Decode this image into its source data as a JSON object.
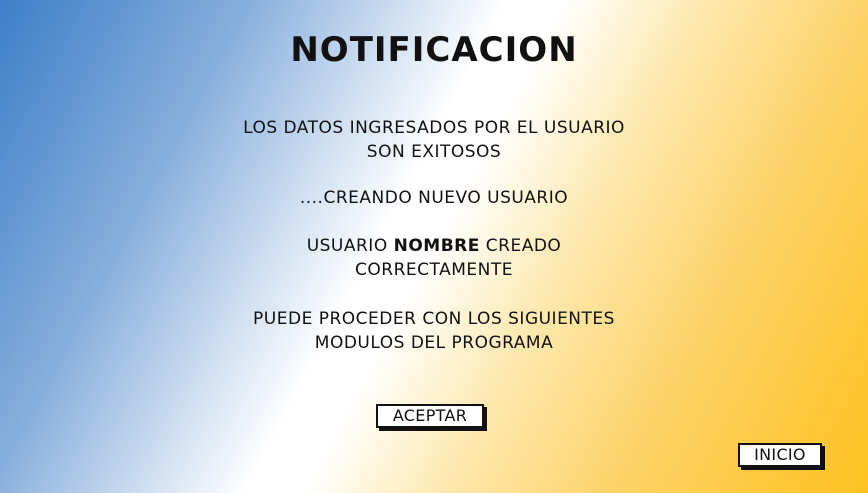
{
  "title": "NOTIFICACION",
  "messages": {
    "success_line1": "LOS DATOS INGRESADOS POR EL USUARIO",
    "success_line2": "SON EXITOSOS",
    "creating": "....CREANDO NUEVO USUARIO",
    "created_prefix": "USUARIO ",
    "created_name": "NOMBRE",
    "created_suffix": " CREADO",
    "created_line2": "CORRECTAMENTE",
    "proceed_line1": "PUEDE PROCEDER CON LOS SIGUIENTES",
    "proceed_line2": "MODULOS DEL PROGRAMA"
  },
  "buttons": {
    "accept_label": "ACEPTAR",
    "home_label": "INICIO"
  },
  "colors": {
    "gradient_blue": "#3d7fc9",
    "gradient_white": "#ffffff",
    "gradient_yellow": "#fec21f"
  }
}
